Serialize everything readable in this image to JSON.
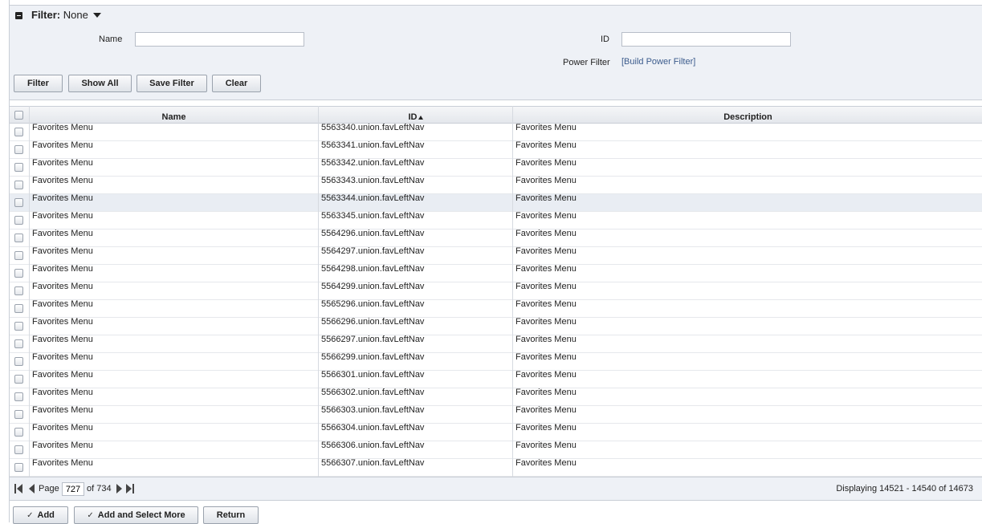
{
  "filter": {
    "title_label": "Filter:",
    "title_value": "None",
    "name_label": "Name",
    "name_value": "",
    "id_label": "ID",
    "id_value": "",
    "power_filter_label": "Power Filter",
    "power_filter_link": "[Build Power Filter]",
    "buttons": {
      "filter": "Filter",
      "show_all": "Show All",
      "save_filter": "Save Filter",
      "clear": "Clear"
    }
  },
  "grid": {
    "columns": [
      "Name",
      "ID",
      "Description"
    ],
    "sort_column": "ID",
    "sort_direction": "ascending",
    "highlighted_row": 4,
    "rows": [
      {
        "name": "Favorites Menu",
        "id": "5563340.union.favLeftNav",
        "description": "Favorites Menu"
      },
      {
        "name": "Favorites Menu",
        "id": "5563341.union.favLeftNav",
        "description": "Favorites Menu"
      },
      {
        "name": "Favorites Menu",
        "id": "5563342.union.favLeftNav",
        "description": "Favorites Menu"
      },
      {
        "name": "Favorites Menu",
        "id": "5563343.union.favLeftNav",
        "description": "Favorites Menu"
      },
      {
        "name": "Favorites Menu",
        "id": "5563344.union.favLeftNav",
        "description": "Favorites Menu"
      },
      {
        "name": "Favorites Menu",
        "id": "5563345.union.favLeftNav",
        "description": "Favorites Menu"
      },
      {
        "name": "Favorites Menu",
        "id": "5564296.union.favLeftNav",
        "description": "Favorites Menu"
      },
      {
        "name": "Favorites Menu",
        "id": "5564297.union.favLeftNav",
        "description": "Favorites Menu"
      },
      {
        "name": "Favorites Menu",
        "id": "5564298.union.favLeftNav",
        "description": "Favorites Menu"
      },
      {
        "name": "Favorites Menu",
        "id": "5564299.union.favLeftNav",
        "description": "Favorites Menu"
      },
      {
        "name": "Favorites Menu",
        "id": "5565296.union.favLeftNav",
        "description": "Favorites Menu"
      },
      {
        "name": "Favorites Menu",
        "id": "5566296.union.favLeftNav",
        "description": "Favorites Menu"
      },
      {
        "name": "Favorites Menu",
        "id": "5566297.union.favLeftNav",
        "description": "Favorites Menu"
      },
      {
        "name": "Favorites Menu",
        "id": "5566299.union.favLeftNav",
        "description": "Favorites Menu"
      },
      {
        "name": "Favorites Menu",
        "id": "5566301.union.favLeftNav",
        "description": "Favorites Menu"
      },
      {
        "name": "Favorites Menu",
        "id": "5566302.union.favLeftNav",
        "description": "Favorites Menu"
      },
      {
        "name": "Favorites Menu",
        "id": "5566303.union.favLeftNav",
        "description": "Favorites Menu"
      },
      {
        "name": "Favorites Menu",
        "id": "5566304.union.favLeftNav",
        "description": "Favorites Menu"
      },
      {
        "name": "Favorites Menu",
        "id": "5566306.union.favLeftNav",
        "description": "Favorites Menu"
      },
      {
        "name": "Favorites Menu",
        "id": "5566307.union.favLeftNav",
        "description": "Favorites Menu"
      }
    ]
  },
  "pager": {
    "page_label": "Page",
    "current_page": "727",
    "of_label": "of 734",
    "display_text": "Displaying 14521 - 14540 of 14673"
  },
  "actions": {
    "add": "Add",
    "add_select_more": "Add and Select More",
    "return": "Return"
  },
  "icons": [
    "collapse-icon",
    "dropdown-caret-icon",
    "sort-asc-icon",
    "first-page-icon",
    "prev-page-icon",
    "next-page-icon",
    "last-page-icon",
    "check-icon"
  ],
  "colors": {
    "panel_bg": "#eef1f6",
    "border": "#c9ced6",
    "link": "#3b5b8c",
    "highlight_row": "#e9edf3"
  }
}
